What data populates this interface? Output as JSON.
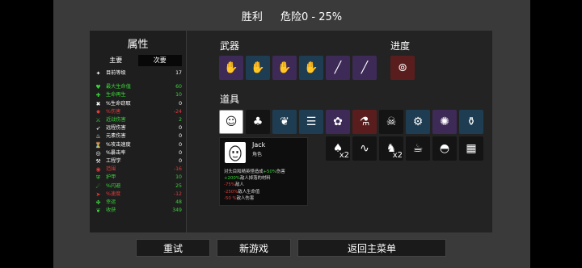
{
  "header": {
    "result": "胜利",
    "danger": "危险0 - 25%"
  },
  "stats": {
    "title": "属性",
    "tabs": [
      "主要",
      "次要"
    ],
    "rows": [
      {
        "icon": "level-icon",
        "glyph": "✦",
        "name": "目前等级",
        "value": "17",
        "color": "#ffffff"
      },
      {
        "spacer": true
      },
      {
        "icon": "heart-icon",
        "glyph": "♥",
        "name": "最大生命值",
        "value": "60",
        "color": "#3bd23b"
      },
      {
        "icon": "regen-icon",
        "glyph": "✚",
        "name": "生命再生",
        "value": "10",
        "color": "#3bd23b"
      },
      {
        "icon": "lifesteal-icon",
        "glyph": "✖",
        "name": "%生命窃取",
        "value": "0",
        "color": "#ffffff"
      },
      {
        "icon": "damage-icon",
        "glyph": "✸",
        "name": "%伤害",
        "value": "-24",
        "color": "#e03b3b"
      },
      {
        "icon": "melee-icon",
        "glyph": "⚔",
        "name": "近战伤害",
        "value": "2",
        "color": "#3bd23b"
      },
      {
        "icon": "ranged-icon",
        "glyph": "➶",
        "name": "远程伤害",
        "value": "0",
        "color": "#ffffff"
      },
      {
        "icon": "elemental-icon",
        "glyph": "♨",
        "name": "元素伤害",
        "value": "0",
        "color": "#ffffff"
      },
      {
        "icon": "attack-speed-icon",
        "glyph": "⏳",
        "name": "%攻击速度",
        "value": "0",
        "color": "#ffffff"
      },
      {
        "icon": "crit-icon",
        "glyph": "◎",
        "name": "%暴击率",
        "value": "0",
        "color": "#ffffff"
      },
      {
        "icon": "engineering-icon",
        "glyph": "⚒",
        "name": "工程学",
        "value": "0",
        "color": "#ffffff"
      },
      {
        "icon": "range-icon",
        "glyph": "◉",
        "name": "范围",
        "value": "-16",
        "color": "#e03b3b"
      },
      {
        "icon": "armor-icon",
        "glyph": "⛨",
        "name": "护甲",
        "value": "10",
        "color": "#3bd23b"
      },
      {
        "icon": "dodge-icon",
        "glyph": "☄",
        "name": "%闪避",
        "value": "25",
        "color": "#3bd23b"
      },
      {
        "icon": "speed-icon",
        "glyph": "➤",
        "name": "%速度",
        "value": "-12",
        "color": "#e03b3b"
      },
      {
        "icon": "luck-icon",
        "glyph": "✤",
        "name": "幸运",
        "value": "48",
        "color": "#3bd23b"
      },
      {
        "icon": "harvest-icon",
        "glyph": "❦",
        "name": "收获",
        "value": "349",
        "color": "#3bd23b"
      }
    ]
  },
  "sections": {
    "weapons": "武器",
    "progress": "进度",
    "items": "道具"
  },
  "weapons": [
    {
      "name": "weapon-slot-1",
      "icon": "hand-icon",
      "glyph": "✋",
      "bg": "purple"
    },
    {
      "name": "weapon-slot-2",
      "icon": "hand-icon",
      "glyph": "✋",
      "bg": "teal"
    },
    {
      "name": "weapon-slot-3",
      "icon": "hand-icon",
      "glyph": "✋",
      "bg": "purple"
    },
    {
      "name": "weapon-slot-4",
      "icon": "hand-icon",
      "glyph": "✋",
      "bg": "teal"
    },
    {
      "name": "weapon-slot-5",
      "icon": "spear-icon",
      "glyph": "╱",
      "bg": "purple"
    },
    {
      "name": "weapon-slot-6",
      "icon": "spear-icon",
      "glyph": "╱",
      "bg": "purple"
    }
  ],
  "progress_item": {
    "icon": "belt-icon",
    "glyph": "⊚",
    "bg": "red"
  },
  "items_row1": [
    {
      "icon": "egg-face-icon",
      "glyph": "☺",
      "bg": "selected",
      "count": ""
    },
    {
      "icon": "mushroom-icon",
      "glyph": "♣",
      "bg": "dark",
      "count": ""
    },
    {
      "icon": "claw-icon",
      "glyph": "❦",
      "bg": "teal",
      "count": ""
    },
    {
      "icon": "ladder-icon",
      "glyph": "☰",
      "bg": "teal",
      "count": ""
    },
    {
      "icon": "brain-icon",
      "glyph": "✿",
      "bg": "purple",
      "count": ""
    },
    {
      "icon": "potion-icon",
      "glyph": "⚗",
      "bg": "red",
      "count": ""
    },
    {
      "icon": "skull-icon",
      "glyph": "☠",
      "bg": "dark",
      "count": ""
    },
    {
      "icon": "gun-turret-icon",
      "glyph": "⚙",
      "bg": "teal",
      "count": ""
    },
    {
      "icon": "bomb-icon",
      "glyph": "✺",
      "bg": "purple",
      "count": ""
    },
    {
      "icon": "flask-icon",
      "glyph": "⚱",
      "bg": "teal",
      "count": ""
    }
  ],
  "items_row2": [
    {
      "icon": "sprout-icon",
      "glyph": "♠",
      "bg": "dark",
      "count": "x2"
    },
    {
      "icon": "snake-icon",
      "glyph": "∿",
      "bg": "dark",
      "count": ""
    },
    {
      "icon": "cape-icon",
      "glyph": "♞",
      "bg": "dark",
      "count": "x2"
    },
    {
      "icon": "drink-icon",
      "glyph": "☕",
      "bg": "dark",
      "count": ""
    },
    {
      "icon": "helmet-icon",
      "glyph": "◓",
      "bg": "dark",
      "count": ""
    },
    {
      "icon": "armor-vest-icon",
      "glyph": "▦",
      "bg": "dark",
      "count": ""
    }
  ],
  "tooltip": {
    "name": "Jack",
    "type": "角色",
    "lines": [
      {
        "parts": [
          {
            "t": "对头目和精英怪造成",
            "c": ""
          },
          {
            "t": "+50%",
            "c": "g"
          },
          {
            "t": "伤害",
            "c": ""
          }
        ]
      },
      {
        "parts": [
          {
            "t": "+200%",
            "c": "g"
          },
          {
            "t": "敌人掉落的材料",
            "c": ""
          }
        ]
      },
      {
        "parts": [
          {
            "t": "-75%",
            "c": "r"
          },
          {
            "t": "敌人",
            "c": ""
          }
        ]
      },
      {
        "parts": [
          {
            "t": "-250%",
            "c": "r"
          },
          {
            "t": "敌人生命值",
            "c": ""
          }
        ]
      },
      {
        "parts": [
          {
            "t": "-50 %",
            "c": "r"
          },
          {
            "t": "敌人伤害",
            "c": ""
          }
        ]
      }
    ]
  },
  "buttons": {
    "retry": "重试",
    "new_game": "新游戏",
    "main_menu": "返回主菜单"
  }
}
